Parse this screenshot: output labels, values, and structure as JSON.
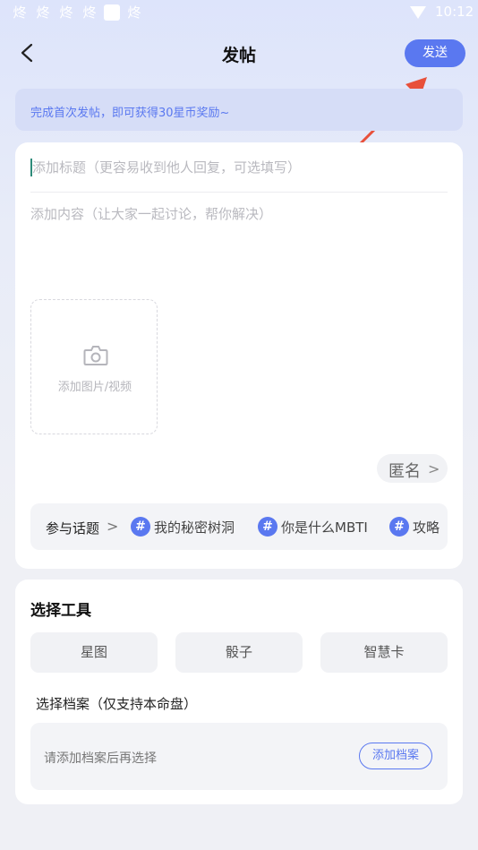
{
  "status_bar": {
    "time": "10:12",
    "notification_icons": [
      "app-notification-icon",
      "app-notification-icon",
      "app-notification-icon",
      "app-notification-icon",
      "square-notification-icon",
      "app-notification-icon"
    ]
  },
  "header": {
    "title": "发帖",
    "send_label": "发送"
  },
  "banner": {
    "text": "完成首次发帖，即可获得30星币奖励~"
  },
  "compose": {
    "title_placeholder": "添加标题（更容易收到他人回复，可选填写）",
    "content_placeholder": "添加内容（让大家一起讨论，帮你解决）",
    "media_label": "添加图片/视频",
    "anonymous_label": "匿名",
    "anonymous_chevron": ">"
  },
  "topics": {
    "label": "参与话题",
    "chevron": ">",
    "items": [
      {
        "hash": "#",
        "label": "我的秘密树洞"
      },
      {
        "hash": "#",
        "label": "你是什么MBTI"
      },
      {
        "hash": "#",
        "label": "攻略"
      }
    ]
  },
  "tools": {
    "title": "选择工具",
    "items": [
      "星图",
      "骰子",
      "智慧卡"
    ]
  },
  "archive": {
    "title": "选择档案（仅支持本命盘）",
    "hint": "请添加档案后再选择",
    "add_label": "添加档案"
  },
  "colors": {
    "accent": "#5a78f0",
    "annotation_arrow": "#e8503a"
  }
}
